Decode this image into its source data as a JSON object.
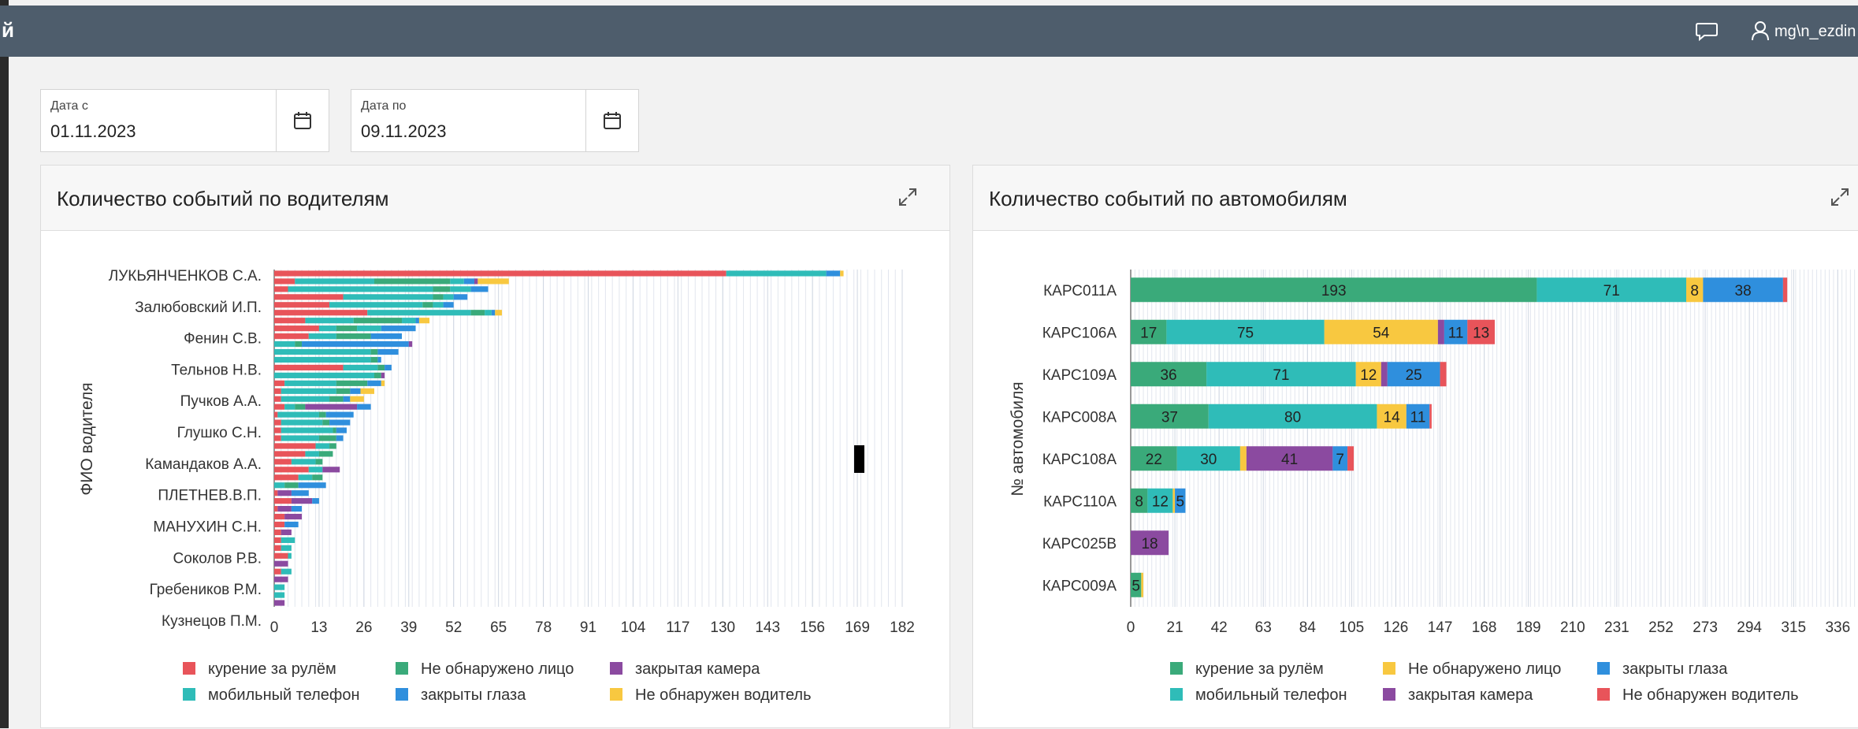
{
  "header": {
    "brand_fragment": "й",
    "user_name": "mg\\n_ezdin",
    "chat_icon": "chat-bubble-icon",
    "user_icon": "user-icon"
  },
  "filters": {
    "date_from": {
      "label": "Дата с",
      "value": "01.11.2023",
      "icon": "calendar-icon"
    },
    "date_to": {
      "label": "Дата по",
      "value": "09.11.2023",
      "icon": "calendar-icon"
    }
  },
  "colors": {
    "smoking": "#e8545a",
    "phone": "#2fbcb8",
    "no_face": "#3aaa7a",
    "eyes_closed": "#2f8fdd",
    "camera_closed": "#8b4aa0",
    "no_driver": "#f8c840"
  },
  "drivers_card": {
    "title": "Количество событий по водителям",
    "expand_icon": "expand-icon"
  },
  "cars_card": {
    "title": "Количество событий по автомобилям",
    "expand_icon": "expand-icon"
  },
  "chart_data": [
    {
      "type": "bar",
      "orientation": "horizontal",
      "stacked": true,
      "title": "Количество событий по водителям",
      "ylabel": "ФИО водителя",
      "xlabel": "",
      "xlim": [
        0,
        182
      ],
      "x_ticks": [
        "0",
        "13",
        "26",
        "39",
        "52",
        "65",
        "78",
        "91",
        "104",
        "117",
        "130",
        "143",
        "156",
        "169",
        "182"
      ],
      "labeled_categories": [
        "ЛУКЬЯНЧЕНКОВ С.А.",
        "Залюбовский И.П.",
        "Фенин С.В.",
        "Тельнов Н.В.",
        "Пучков А.А.",
        "Глушко С.Н.",
        "Камандаков А.А.",
        "ПЛЕТНЕВ.В.П.",
        "МАНУХИН С.Н.",
        "Соколов Р.В.",
        "Гребеников Р.М.",
        "Кузнецов П.М."
      ],
      "legend": {
        "position": "bottom",
        "items": [
          {
            "name": "курение за рулём",
            "color": "#e8545a"
          },
          {
            "name": "Не обнаружено лицо",
            "color": "#3aaa7a"
          },
          {
            "name": "закрытая камера",
            "color": "#8b4aa0"
          },
          {
            "name": "мобильный телефон",
            "color": "#2fbcb8"
          },
          {
            "name": "закрыты глаза",
            "color": "#2f8fdd"
          },
          {
            "name": "Не обнаружен водитель",
            "color": "#f8c840"
          }
        ]
      },
      "rows": [
        [
          [
            "smoking",
            131
          ],
          [
            "phone",
            29
          ],
          [
            "eyes_closed",
            4
          ],
          [
            "no_driver",
            1
          ]
        ],
        [
          [
            "smoking",
            6
          ],
          [
            "phone",
            23
          ],
          [
            "no_face",
            22
          ],
          [
            "phone",
            4
          ],
          [
            "eyes_closed",
            3
          ],
          [
            "camera_closed",
            1
          ],
          [
            "no_driver",
            9
          ]
        ],
        [
          [
            "smoking",
            4
          ],
          [
            "phone",
            42
          ],
          [
            "no_face",
            5
          ],
          [
            "phone",
            6
          ],
          [
            "eyes_closed",
            5
          ]
        ],
        [
          [
            "smoking",
            20
          ],
          [
            "phone",
            26
          ],
          [
            "no_face",
            3
          ],
          [
            "phone",
            3
          ],
          [
            "eyes_closed",
            4
          ]
        ],
        [
          [
            "smoking",
            16
          ],
          [
            "phone",
            27
          ],
          [
            "no_face",
            3
          ],
          [
            "phone",
            3
          ],
          [
            "eyes_closed",
            3
          ]
        ],
        [
          [
            "smoking",
            27
          ],
          [
            "phone",
            30
          ],
          [
            "no_face",
            4
          ],
          [
            "phone",
            2
          ],
          [
            "eyes_closed",
            1
          ],
          [
            "no_driver",
            2
          ]
        ],
        [
          [
            "smoking",
            9
          ],
          [
            "phone",
            14
          ],
          [
            "no_face",
            14
          ],
          [
            "phone",
            4
          ],
          [
            "eyes_closed",
            1
          ],
          [
            "no_driver",
            3
          ]
        ],
        [
          [
            "smoking",
            13
          ],
          [
            "phone",
            5
          ],
          [
            "no_face",
            6
          ],
          [
            "phone",
            7
          ],
          [
            "eyes_closed",
            10
          ]
        ],
        [
          [
            "smoking",
            10
          ],
          [
            "phone",
            8
          ],
          [
            "no_face",
            10
          ],
          [
            "eyes_closed",
            9
          ]
        ],
        [
          [
            "phone",
            6
          ],
          [
            "no_face",
            2
          ],
          [
            "eyes_closed",
            31
          ],
          [
            "camera_closed",
            1
          ]
        ],
        [
          [
            "phone",
            28
          ],
          [
            "no_face",
            2
          ],
          [
            "eyes_closed",
            6
          ]
        ],
        [
          [
            "phone",
            28
          ],
          [
            "no_face",
            2
          ],
          [
            "eyes_closed",
            1
          ]
        ],
        [
          [
            "smoking",
            20
          ],
          [
            "phone",
            10
          ],
          [
            "no_face",
            2
          ],
          [
            "eyes_closed",
            2
          ]
        ],
        [
          [
            "phone",
            29
          ],
          [
            "no_face",
            2
          ],
          [
            "camera_closed",
            1
          ]
        ],
        [
          [
            "smoking",
            3
          ],
          [
            "phone",
            15
          ],
          [
            "no_face",
            9
          ],
          [
            "eyes_closed",
            4
          ],
          [
            "no_driver",
            1
          ]
        ],
        [
          [
            "smoking",
            2
          ],
          [
            "phone",
            16
          ],
          [
            "no_face",
            4
          ],
          [
            "eyes_closed",
            3
          ],
          [
            "no_driver",
            4
          ]
        ],
        [
          [
            "smoking",
            2
          ],
          [
            "phone",
            14
          ],
          [
            "no_face",
            4
          ],
          [
            "eyes_closed",
            2
          ],
          [
            "no_driver",
            4
          ]
        ],
        [
          [
            "smoking",
            3
          ],
          [
            "phone",
            3
          ],
          [
            "no_face",
            3
          ],
          [
            "camera_closed",
            15
          ],
          [
            "eyes_closed",
            4
          ]
        ],
        [
          [
            "smoking",
            1
          ],
          [
            "phone",
            12
          ],
          [
            "no_face",
            2
          ],
          [
            "eyes_closed",
            8
          ]
        ],
        [
          [
            "smoking",
            2
          ],
          [
            "phone",
            12
          ],
          [
            "no_face",
            2
          ],
          [
            "eyes_closed",
            6
          ]
        ],
        [
          [
            "smoking",
            2
          ],
          [
            "phone",
            15
          ],
          [
            "no_face",
            1
          ],
          [
            "eyes_closed",
            3
          ]
        ],
        [
          [
            "smoking",
            2
          ],
          [
            "phone",
            11
          ],
          [
            "no_face",
            5
          ],
          [
            "eyes_closed",
            2
          ]
        ],
        [
          [
            "smoking",
            12
          ],
          [
            "phone",
            4
          ],
          [
            "no_face",
            2
          ]
        ],
        [
          [
            "smoking",
            9
          ],
          [
            "phone",
            4
          ],
          [
            "no_face",
            4
          ]
        ],
        [
          [
            "smoking",
            5
          ],
          [
            "phone",
            7
          ],
          [
            "no_face",
            2
          ]
        ],
        [
          [
            "smoking",
            10
          ],
          [
            "phone",
            4
          ],
          [
            "camera_closed",
            5
          ]
        ],
        [
          [
            "smoking",
            7
          ],
          [
            "phone",
            4
          ],
          [
            "no_face",
            3
          ]
        ],
        [
          [
            "phone",
            3
          ],
          [
            "no_face",
            4
          ],
          [
            "eyes_closed",
            8
          ]
        ],
        [
          [
            "smoking",
            1
          ],
          [
            "camera_closed",
            4
          ],
          [
            "eyes_closed",
            5
          ]
        ],
        [
          [
            "smoking",
            5
          ],
          [
            "camera_closed",
            6
          ],
          [
            "eyes_closed",
            2
          ]
        ],
        [
          [
            "smoking",
            1
          ],
          [
            "camera_closed",
            4
          ],
          [
            "eyes_closed",
            3
          ]
        ],
        [
          [
            "smoking",
            3
          ],
          [
            "camera_closed",
            5
          ]
        ],
        [
          [
            "smoking",
            3
          ],
          [
            "eyes_closed",
            4
          ]
        ],
        [
          [
            "smoking",
            2
          ],
          [
            "camera_closed",
            3
          ]
        ],
        [
          [
            "smoking",
            2
          ],
          [
            "phone",
            4
          ]
        ],
        [
          [
            "smoking",
            2
          ],
          [
            "phone",
            3
          ]
        ],
        [
          [
            "smoking",
            4
          ],
          [
            "phone",
            1
          ]
        ],
        [
          [
            "camera_closed",
            4
          ]
        ],
        [
          [
            "smoking",
            2
          ],
          [
            "phone",
            3
          ]
        ],
        [
          [
            "camera_closed",
            4
          ]
        ],
        [
          [
            "phone",
            3
          ]
        ],
        [
          [
            "phone",
            3
          ]
        ],
        [
          [
            "camera_closed",
            3
          ]
        ]
      ],
      "label_rows": [
        0,
        4,
        8,
        12,
        16,
        20,
        24,
        28,
        32,
        36,
        40,
        44
      ]
    },
    {
      "type": "bar",
      "orientation": "horizontal",
      "stacked": true,
      "title": "Количество событий по автомобилям",
      "ylabel": "№ автомобиля",
      "xlabel": "",
      "xlim": [
        0,
        346
      ],
      "x_ticks": [
        "0",
        "21",
        "42",
        "63",
        "84",
        "105",
        "126",
        "147",
        "168",
        "189",
        "210",
        "231",
        "252",
        "273",
        "294",
        "315",
        "336"
      ],
      "categories": [
        "КАРС011А",
        "КАРС106А",
        "КАРС109А",
        "КАРС008А",
        "КАРС108А",
        "КАРС110А",
        "КАРС025В",
        "КАРС009А"
      ],
      "series": [
        {
          "name": "курение за рулём",
          "key": "no_face",
          "color": "#3aaa7a",
          "values": [
            193,
            17,
            36,
            37,
            22,
            8,
            0,
            5
          ]
        },
        {
          "name": "мобильный телефон",
          "key": "phone",
          "color": "#2fbcb8",
          "values": [
            71,
            75,
            71,
            80,
            30,
            12,
            0,
            0
          ]
        },
        {
          "name": "Не обнаружено лицо",
          "key": "no_driver",
          "color": "#f8c840",
          "values": [
            8,
            54,
            12,
            14,
            3,
            1,
            0,
            1
          ]
        },
        {
          "name": "закрытая камера",
          "key": "camera_closed",
          "color": "#8b4aa0",
          "values": [
            0,
            3,
            3,
            0,
            41,
            0,
            18,
            0
          ]
        },
        {
          "name": "закрыты глаза",
          "key": "eyes_closed",
          "color": "#2f8fdd",
          "values": [
            38,
            11,
            25,
            11,
            7,
            5,
            0,
            0
          ]
        },
        {
          "name": "Не обнаружен водитель",
          "key": "smoking",
          "color": "#e8545a",
          "values": [
            2,
            13,
            3,
            1,
            3,
            0,
            0,
            0
          ]
        }
      ],
      "legend": {
        "position": "bottom",
        "items": [
          {
            "name": "курение за рулём",
            "color": "#3aaa7a"
          },
          {
            "name": "Не обнаружено лицо",
            "color": "#f8c840"
          },
          {
            "name": "закрыты глаза",
            "color": "#2f8fdd"
          },
          {
            "name": "мобильный телефон",
            "color": "#2fbcb8"
          },
          {
            "name": "закрытая камера",
            "color": "#8b4aa0"
          },
          {
            "name": "Не обнаружен водитель",
            "color": "#e8545a"
          }
        ]
      },
      "label_min": 5
    }
  ]
}
